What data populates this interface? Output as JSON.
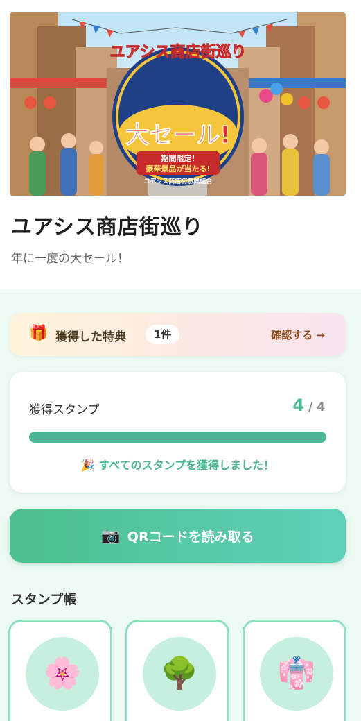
{
  "banner": {
    "headline": "ユアシス商店街巡り",
    "sale_text": "大セール!",
    "limited": "期間限定!",
    "prize": "豪華景品が当たる!",
    "footer": "ユアシス商店街振興組合"
  },
  "header": {
    "title": "ユアシス商店街巡り",
    "subtitle": "年に一度の大セール！"
  },
  "reward": {
    "icon": "gift-icon",
    "label": "獲得した特典",
    "count": "1件",
    "link": "確認する →"
  },
  "stamps": {
    "label": "獲得スタンプ",
    "current": "4",
    "separator": "/",
    "total": "4",
    "progress": 1.0,
    "complete_message": "🎉 すべてのスタンプを獲得しました！"
  },
  "qr_button": {
    "icon": "📷",
    "label": "QRコードを読み取る"
  },
  "stamp_book": {
    "title": "スタンプ帳",
    "items": [
      {
        "icon": "🌸",
        "name": "cherry-blossom-icon"
      },
      {
        "icon": "🌳",
        "name": "tree-icon"
      },
      {
        "icon": "👘",
        "name": "kimono-icon"
      }
    ]
  },
  "colors": {
    "accent": "#49b593",
    "background": "#eefaf4"
  }
}
